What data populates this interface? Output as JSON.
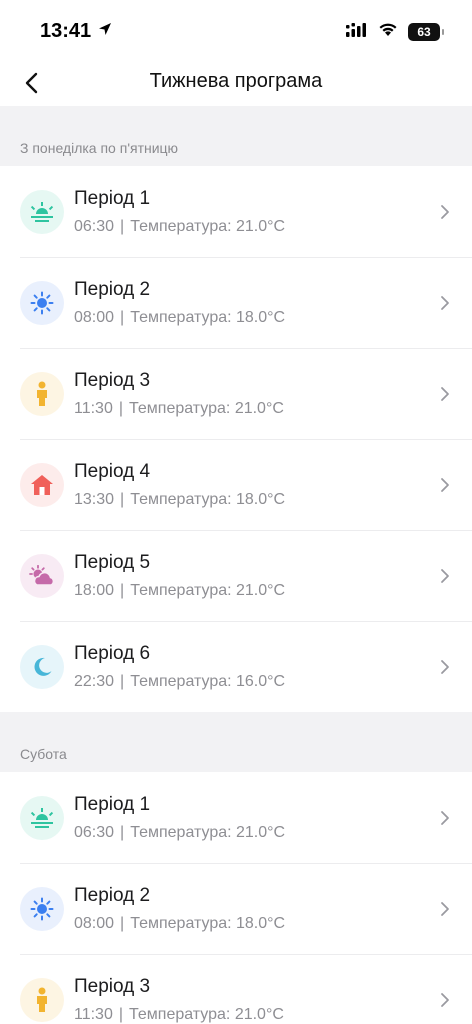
{
  "status": {
    "time": "13:41",
    "battery": "63"
  },
  "header": {
    "title": "Тижнева програма"
  },
  "colors": {
    "sunrise": "#2ec4a0",
    "sunrise_bg": "#e6f8f3",
    "sun": "#3b7ff0",
    "sun_bg": "#e9f0fd",
    "person": "#f2b430",
    "person_bg": "#fdf5e3",
    "home": "#f0605a",
    "home_bg": "#fdeceb",
    "cloud": "#c56aa9",
    "cloud_bg": "#f8ebf4",
    "moon": "#47b6d8",
    "moon_bg": "#e6f5fa"
  },
  "sections": [
    {
      "title": "З понеділка по п'ятницю",
      "periods": [
        {
          "icon": "sunrise-icon",
          "label": "Період 1",
          "time": "06:30",
          "sep": "|",
          "temp": "Температура: 21.0°C"
        },
        {
          "icon": "sun-icon",
          "label": "Період 2",
          "time": "08:00",
          "sep": "|",
          "temp": "Температура: 18.0°C"
        },
        {
          "icon": "person-icon",
          "label": "Період 3",
          "time": "11:30",
          "sep": "|",
          "temp": "Температура: 21.0°C"
        },
        {
          "icon": "home-icon",
          "label": "Період 4",
          "time": "13:30",
          "sep": "|",
          "temp": "Температура: 18.0°C"
        },
        {
          "icon": "sunset-cloud-icon",
          "label": "Період 5",
          "time": "18:00",
          "sep": "|",
          "temp": "Температура: 21.0°C"
        },
        {
          "icon": "moon-icon",
          "label": "Період 6",
          "time": "22:30",
          "sep": "|",
          "temp": "Температура: 16.0°C"
        }
      ]
    },
    {
      "title": "Субота",
      "periods": [
        {
          "icon": "sunrise-icon",
          "label": "Період 1",
          "time": "06:30",
          "sep": "|",
          "temp": "Температура: 21.0°C"
        },
        {
          "icon": "sun-icon",
          "label": "Період 2",
          "time": "08:00",
          "sep": "|",
          "temp": "Температура: 18.0°C"
        },
        {
          "icon": "person-icon",
          "label": "Період 3",
          "time": "11:30",
          "sep": "|",
          "temp": "Температура: 21.0°C"
        }
      ]
    }
  ]
}
